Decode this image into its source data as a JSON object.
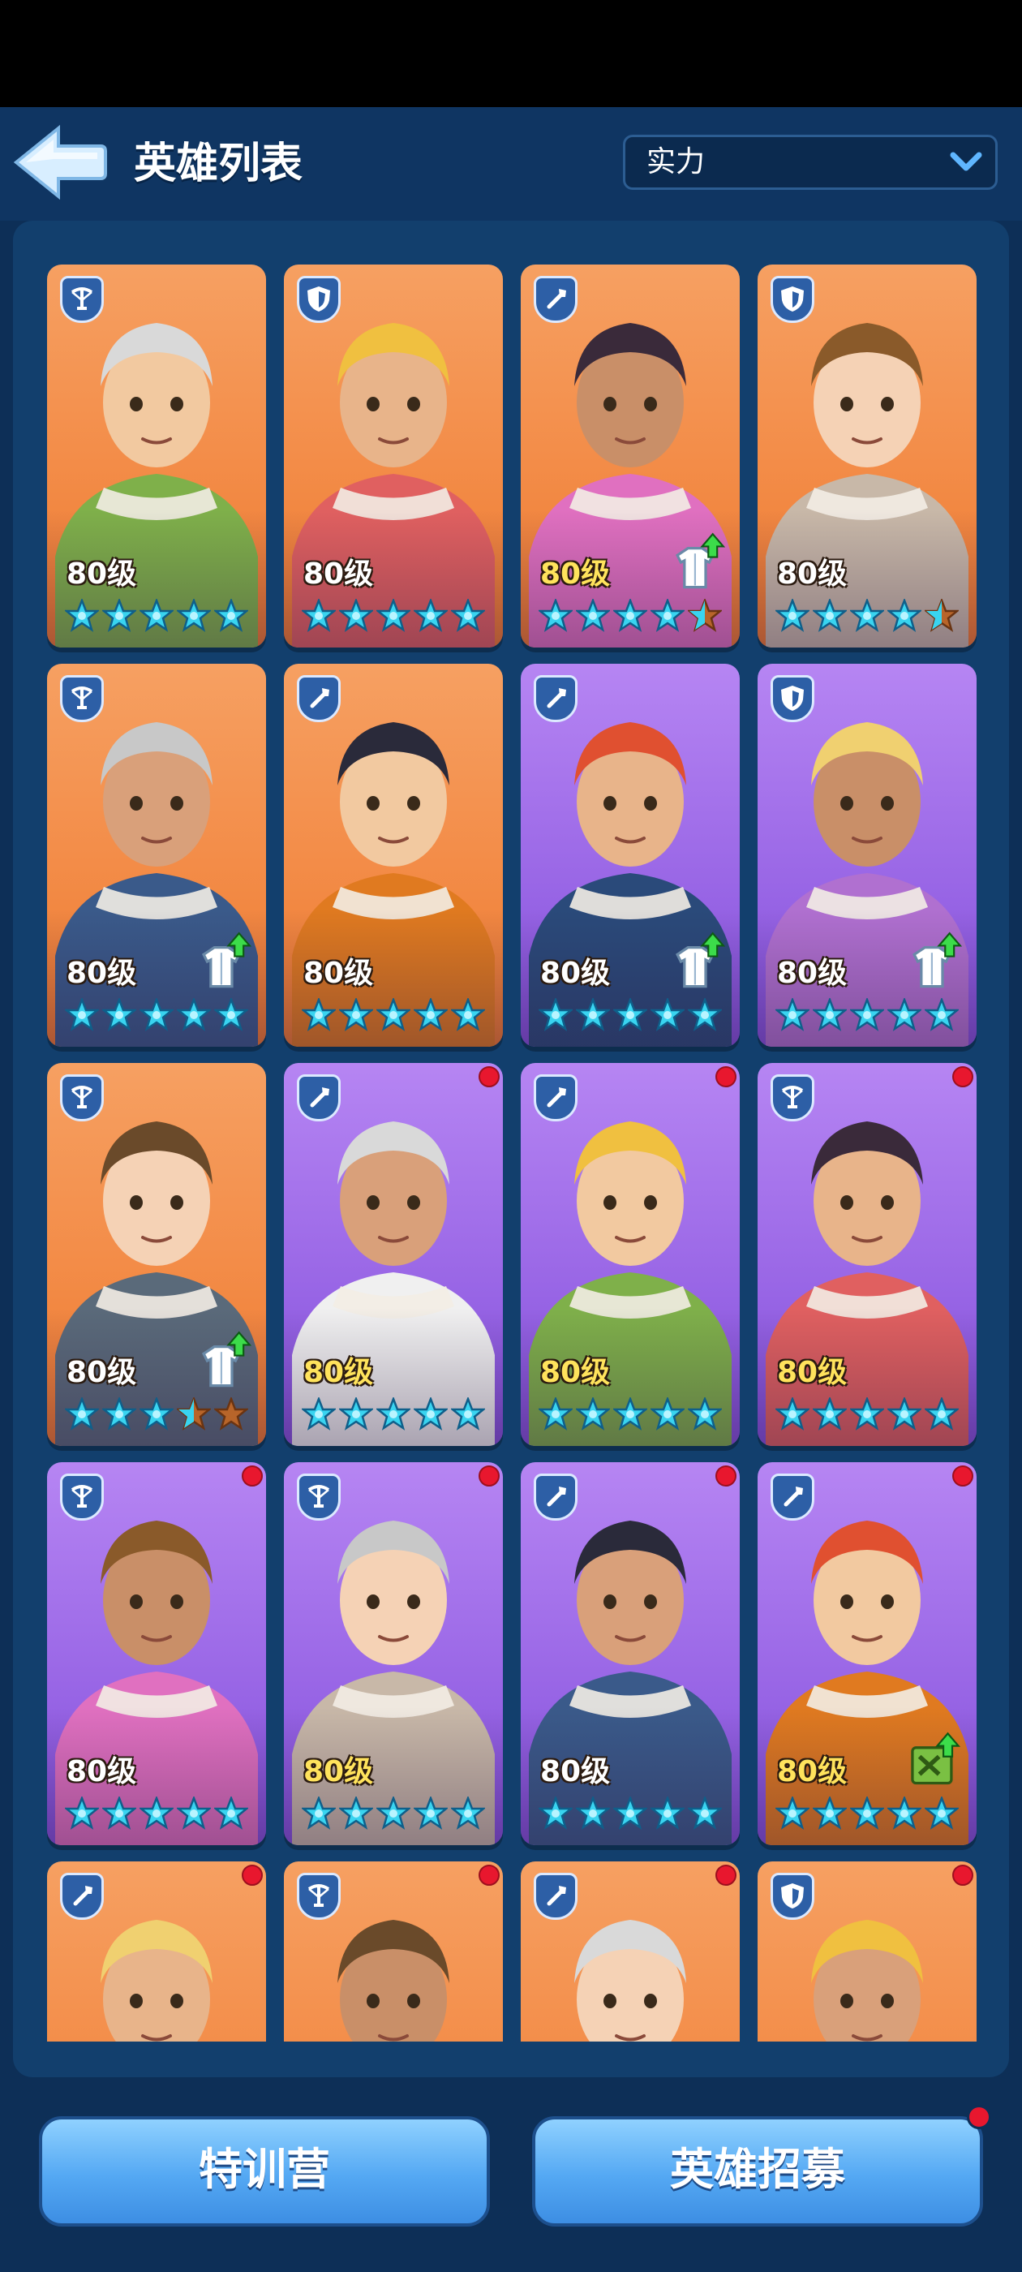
{
  "header": {
    "title": "英雄列表",
    "sort_label": "实力",
    "back_icon": "back-arrow-icon",
    "chevron_icon": "chevron-down-icon"
  },
  "heroes": [
    {
      "level": "80级",
      "role": "crossbow",
      "bg": "orange",
      "stars_full": 5,
      "upgrade": false,
      "red_dot": false,
      "gold_level": false
    },
    {
      "level": "80级",
      "role": "shield",
      "bg": "orange",
      "stars_full": 5,
      "upgrade": false,
      "red_dot": false,
      "gold_level": false
    },
    {
      "level": "80级",
      "role": "staff",
      "bg": "orange",
      "stars_full": 4.5,
      "upgrade": true,
      "upgrade_icon": "outfit-upgrade-icon",
      "red_dot": false,
      "gold_level": true
    },
    {
      "level": "80级",
      "role": "shield",
      "bg": "orange",
      "stars_full": 4.5,
      "upgrade": false,
      "red_dot": false,
      "gold_level": false
    },
    {
      "level": "80级",
      "role": "crossbow",
      "bg": "orange",
      "stars_full": 5,
      "upgrade": true,
      "upgrade_icon": "outfit-upgrade-icon",
      "red_dot": false,
      "gold_level": false
    },
    {
      "level": "80级",
      "role": "staff",
      "bg": "orange",
      "stars_full": 5,
      "upgrade": false,
      "red_dot": false,
      "gold_level": false
    },
    {
      "level": "80级",
      "role": "staff",
      "bg": "purple",
      "stars_full": 5,
      "upgrade": true,
      "upgrade_icon": "outfit-upgrade-icon",
      "red_dot": false,
      "gold_level": false
    },
    {
      "level": "80级",
      "role": "shield",
      "bg": "purple",
      "stars_full": 5,
      "upgrade": true,
      "upgrade_icon": "outfit-upgrade-icon",
      "red_dot": false,
      "gold_level": false
    },
    {
      "level": "80级",
      "role": "crossbow",
      "bg": "orange",
      "stars_full": 3.5,
      "upgrade": true,
      "upgrade_icon": "outfit-upgrade-icon",
      "red_dot": false,
      "gold_level": false
    },
    {
      "level": "80级",
      "role": "staff",
      "bg": "purple",
      "stars_full": 5,
      "upgrade": false,
      "red_dot": true,
      "gold_level": true
    },
    {
      "level": "80级",
      "role": "staff",
      "bg": "purple",
      "stars_full": 5,
      "upgrade": false,
      "red_dot": true,
      "gold_level": true
    },
    {
      "level": "80级",
      "role": "crossbow",
      "bg": "purple",
      "stars_full": 5,
      "upgrade": false,
      "red_dot": true,
      "gold_level": true
    },
    {
      "level": "80级",
      "role": "crossbow",
      "bg": "purple",
      "stars_full": 5,
      "upgrade": false,
      "red_dot": true,
      "gold_level": false
    },
    {
      "level": "80级",
      "role": "crossbow",
      "bg": "purple",
      "stars_full": 5,
      "upgrade": false,
      "red_dot": true,
      "gold_level": true
    },
    {
      "level": "80级",
      "role": "staff",
      "bg": "purple",
      "stars_full": 5,
      "upgrade": false,
      "red_dot": true,
      "gold_level": false
    },
    {
      "level": "80级",
      "role": "staff",
      "bg": "purple",
      "stars_full": 5,
      "upgrade": true,
      "upgrade_icon": "skill-book-upgrade-icon",
      "red_dot": true,
      "gold_level": true
    },
    {
      "level": "",
      "role": "staff",
      "bg": "orange",
      "stars_full": 0,
      "upgrade": false,
      "red_dot": true,
      "gold_level": false
    },
    {
      "level": "",
      "role": "crossbow",
      "bg": "orange",
      "stars_full": 0,
      "upgrade": false,
      "red_dot": true,
      "gold_level": false
    },
    {
      "level": "",
      "role": "staff",
      "bg": "orange",
      "stars_full": 0,
      "upgrade": false,
      "red_dot": true,
      "gold_level": false
    },
    {
      "level": "",
      "role": "shield",
      "bg": "orange",
      "stars_full": 0,
      "upgrade": false,
      "red_dot": true,
      "gold_level": false
    }
  ],
  "buttons": {
    "training": "特训营",
    "recruit": "英雄招募",
    "recruit_has_notification": true
  },
  "colors": {
    "background": "#0d2f57",
    "panel": "#123f6d",
    "card_orange": "#f07a30",
    "card_purple": "#8450dc",
    "star_cyan": "#39d4f0",
    "star_empty": "#b8652a",
    "notification_red": "#e8172e",
    "button_blue": "#54a8f3"
  }
}
